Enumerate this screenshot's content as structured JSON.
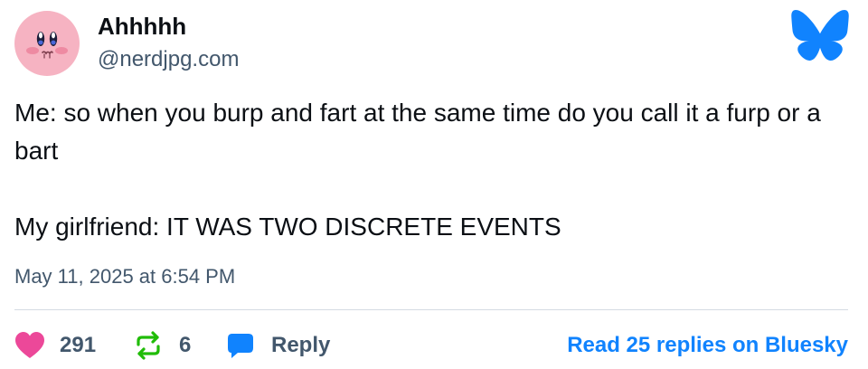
{
  "author": {
    "display_name": "Ahhhhh",
    "handle": "@nerdjpg.com",
    "avatar_icon": "kirby-avatar-icon"
  },
  "brand": {
    "logo_icon": "bluesky-butterfly-icon",
    "color": "#1083fe"
  },
  "post": {
    "paragraphs": [
      "Me: so when you burp and fart at the same time do you call it a furp or a bart",
      "My girlfriend: IT WAS TWO DISCRETE EVENTS"
    ],
    "timestamp": "May 11, 2025 at 6:54 PM"
  },
  "actions": {
    "like_count": "291",
    "like_icon": "heart-icon",
    "like_color": "#ec4899",
    "repost_count": "6",
    "repost_icon": "repost-icon",
    "repost_color": "#20bc07",
    "reply_label": "Reply",
    "reply_icon": "speech-bubble-icon",
    "reply_color": "#1083fe",
    "read_more_label": "Read 25 replies on Bluesky"
  }
}
